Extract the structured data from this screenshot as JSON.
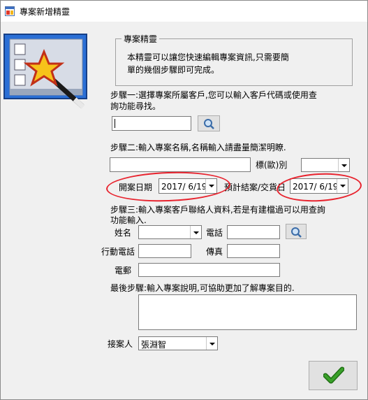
{
  "window": {
    "title": "專案新增精靈"
  },
  "group": {
    "legend": "專案精靈",
    "description_lines": [
      "本精靈可以讓您快速編輯專案資訊,只需要簡",
      "單的幾個步驟即可完成。"
    ]
  },
  "step1": {
    "text_lines": [
      "步驟一:選擇專案所屬客戶,您可以輸入客戶代碼或使用查",
      "詢功能尋找。"
    ],
    "customer_value": ""
  },
  "step2": {
    "text": "步驟二:輸入專案名稱,名稱輸入請盡量簡潔明瞭.",
    "project_name_value": "",
    "category_label": "標(歐)別",
    "category_value": "",
    "start_date_label": "開案日期",
    "start_date_value": "2017/ 6/19",
    "end_date_label": "預計結案/交貨日",
    "end_date_value": "2017/ 6/19"
  },
  "step3": {
    "text_lines": [
      "步驟三:輸入專案客戶聯絡人資料,若是有建檔過可以用查詢",
      "功能輸入."
    ],
    "name_label": "姓名",
    "phone_label": "電話",
    "mobile_label": "行動電話",
    "fax_label": "傳真",
    "email_label": "電郵"
  },
  "final_step": {
    "text": "最後步驟:輸入專案說明,可協助更加了解專案目的."
  },
  "receiver": {
    "label": "接案人",
    "value": "張淵智"
  },
  "icons": {
    "app": "app-window-icon",
    "search": "magnifier-icon",
    "confirm": "green-checkmark-icon",
    "wizard": "wizard-star-wand-icon"
  },
  "colors": {
    "annotation": "#e8232e",
    "check": "#3aa12a",
    "banner": "#2a6fd6"
  }
}
